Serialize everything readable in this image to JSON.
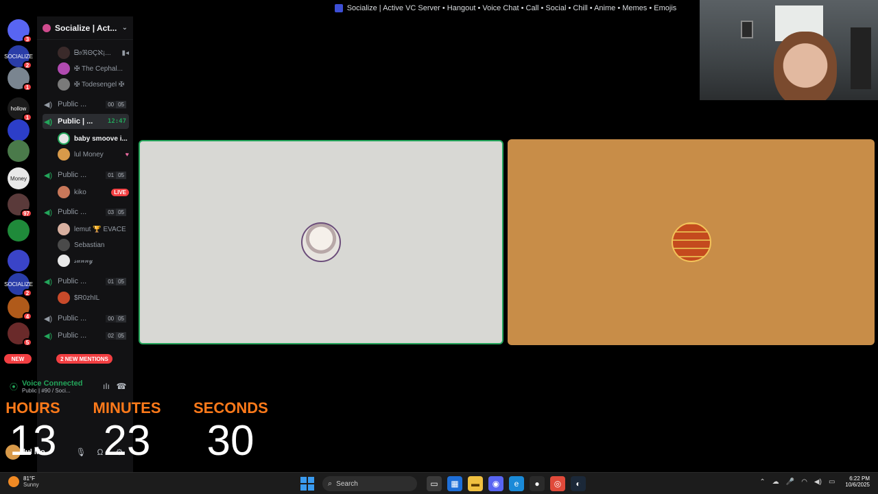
{
  "window": {
    "title": "Socialize | Active VC Server • Hangout • Voice Chat • Call • Social • Chill • Anime • Memes • Emojis"
  },
  "server_rail": {
    "items": [
      {
        "name": "discord-home",
        "label": "",
        "color": "#5865f2",
        "badge": "3"
      },
      {
        "name": "socialize",
        "label": "SOCIALIZE",
        "color": "#2a3da8",
        "badge": "2"
      },
      {
        "name": "server-3",
        "label": "",
        "color": "#7a8590",
        "badge": "1"
      },
      {
        "name": "hollow",
        "label": "hollow",
        "color": "#1b1b1b",
        "badge": "1"
      },
      {
        "name": "server-5",
        "label": "",
        "color": "#2c3ec8",
        "badge": ""
      },
      {
        "name": "server-6",
        "label": "",
        "color": "#4a7a4a",
        "badge": ""
      },
      {
        "name": "money",
        "label": "Money",
        "color": "#e8e8e8",
        "badge": ""
      },
      {
        "name": "server-8",
        "label": "",
        "color": "#5a3a3a",
        "badge": "97"
      },
      {
        "name": "server-9",
        "label": "",
        "color": "#1f8a3a",
        "badge": ""
      },
      {
        "name": "folder",
        "label": "",
        "color": "#3a44c8",
        "badge": ""
      },
      {
        "name": "socialize-2",
        "label": "SOCIALIZE",
        "color": "#2a3da8",
        "badge": "2"
      },
      {
        "name": "server-12",
        "label": "",
        "color": "#b05a1a",
        "badge": "4"
      },
      {
        "name": "server-13",
        "label": "",
        "color": "#6a2a2a",
        "badge": "5"
      }
    ],
    "new_label": "NEW"
  },
  "guild": {
    "name": "Socialize | Act..."
  },
  "channels": {
    "top_users": [
      {
        "name": "ᗷ𝔬ℜΘÇℵ¡...",
        "color": "#3a2a2a"
      },
      {
        "name": "✠ The Cephal...",
        "color": "#b04ab0"
      },
      {
        "name": "✠ Todesengel ✠",
        "color": "#7a7a7a"
      }
    ],
    "list": [
      {
        "name": "Public ...",
        "count_a": "00",
        "count_b": "05"
      },
      {
        "name": "Public | ...",
        "timer": "12:47"
      },
      {
        "name": "Public ...",
        "count_a": "01",
        "count_b": "05"
      },
      {
        "name": "Public ...",
        "count_a": "03",
        "count_b": "05"
      },
      {
        "name": "Public ...",
        "count_a": "01",
        "count_b": "05"
      },
      {
        "name": "Public ...",
        "count_a": "00",
        "count_b": "05"
      },
      {
        "name": "Public ...",
        "count_a": "02",
        "count_b": "05"
      }
    ],
    "active_users": [
      {
        "name": "baby smoove i...",
        "color": "#e6e6e6"
      },
      {
        "name": "lul Money",
        "color": "#d89a4a"
      }
    ],
    "live_user": {
      "name": "kiko",
      "color": "#c8785a",
      "live": "LIVE"
    },
    "group_users": [
      {
        "name": "lemut 🏆 EVACE",
        "color": "#d8b0a0"
      },
      {
        "name": "Sebastian",
        "color": "#4a4a4a"
      },
      {
        "name": "𝓈𝓊𝓃𝓃𝓎",
        "color": "#e8e8e8"
      }
    ],
    "solo_user": {
      "name": "$R0zhIL",
      "color": "#c84a2a"
    },
    "mentions": "2 NEW MENTIONS"
  },
  "voice": {
    "status": "Voice Connected",
    "channel": "Public | #90 / Soci..."
  },
  "userbar": {
    "name": "lul Mo"
  },
  "countdown": {
    "hours_label": "HOURS",
    "hours": "13",
    "minutes_label": "MINUTES",
    "minutes": "23",
    "seconds_label": "SECONDS",
    "seconds": "30"
  },
  "taskbar": {
    "weather_temp": "81°F",
    "weather_cond": "Sunny",
    "search_placeholder": "Search",
    "time": "6:22 PM",
    "date": "10/6/2025"
  }
}
